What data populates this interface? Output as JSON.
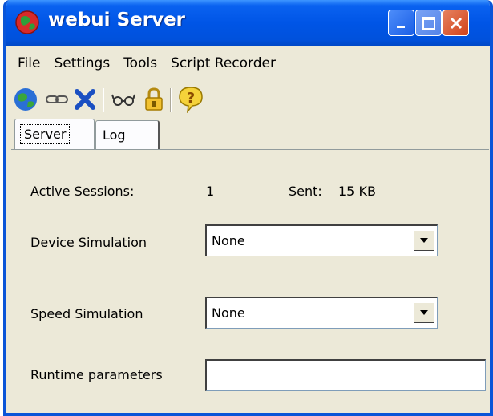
{
  "window": {
    "title": "webui Server",
    "icon": "globe-app-icon",
    "controls": [
      "minimize-icon",
      "maximize-icon",
      "close-icon"
    ]
  },
  "menu": {
    "file": "File",
    "settings": "Settings",
    "tools": "Tools",
    "script_recorder": "Script Recorder"
  },
  "toolbar": {
    "icons": [
      "globe-icon",
      "link-icon",
      "delete-icon",
      "glasses-icon",
      "lock-icon",
      "help-icon"
    ]
  },
  "tabs": {
    "server": "Server",
    "log": "Log",
    "selected": "Server"
  },
  "server": {
    "active_sessions_label": "Active Sessions:",
    "active_sessions_value": "1",
    "sent_label": "Sent:",
    "sent_value": "15 KB",
    "device_simulation_label": "Device Simulation",
    "device_simulation_value": "None",
    "speed_simulation_label": "Speed Simulation",
    "speed_simulation_value": "None",
    "runtime_parameters_label": "Runtime parameters",
    "runtime_parameters_value": ""
  },
  "colors": {
    "titlebar": "#0055e6",
    "window_bg": "#ece9d8",
    "close_button": "#d1421a"
  }
}
